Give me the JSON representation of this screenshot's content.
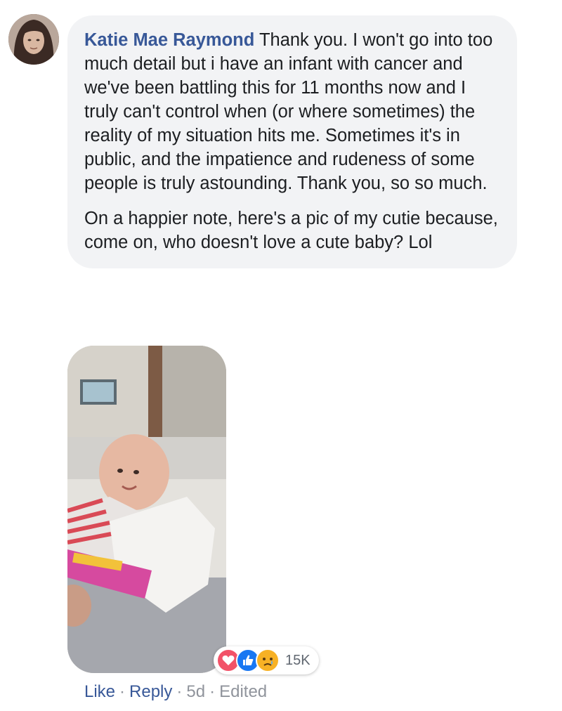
{
  "comment": {
    "author": "Katie Mae Raymond",
    "paragraphs": [
      "Thank you. I won't go into too much detail but i have an infant with cancer and we've been battling this for 11 months now and I truly can't control when (or where sometimes) the reality of my situation hits me. Sometimes it's in public, and the impatience and rudeness of some people is truly astounding. Thank you, so so much.",
      "On a happier note, here's a pic of my cutie because, come on, who doesn't love a cute baby? Lol"
    ]
  },
  "reactions": {
    "icons": [
      "love-icon",
      "like-icon",
      "sad-icon"
    ],
    "count": "15K"
  },
  "actions": {
    "like": "Like",
    "reply": "Reply",
    "time": "5d",
    "edited": "Edited",
    "separator": "·"
  },
  "colors": {
    "link": "#385898",
    "bubble": "#f2f3f5",
    "meta": "#90949c",
    "love": "#f25268",
    "like": "#1877f2",
    "sad": "#f7b125"
  }
}
